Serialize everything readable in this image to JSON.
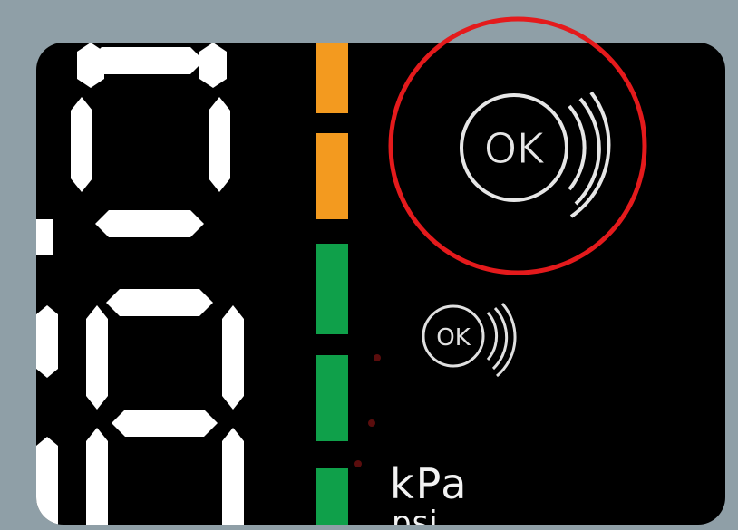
{
  "display": {
    "status_icon_large": {
      "label": "OK",
      "icon": "tpms-ok-icon",
      "highlighted": true
    },
    "status_icon_small": {
      "label": "OK",
      "icon": "tpms-ok-icon"
    },
    "unit_primary": "kPa",
    "unit_secondary": "psi",
    "bar_colors": [
      "#f39a1f",
      "#f39a1f",
      "#0fa04a",
      "#0fa04a",
      "#0fa04a"
    ],
    "highlight_color": "#e41a1c"
  }
}
